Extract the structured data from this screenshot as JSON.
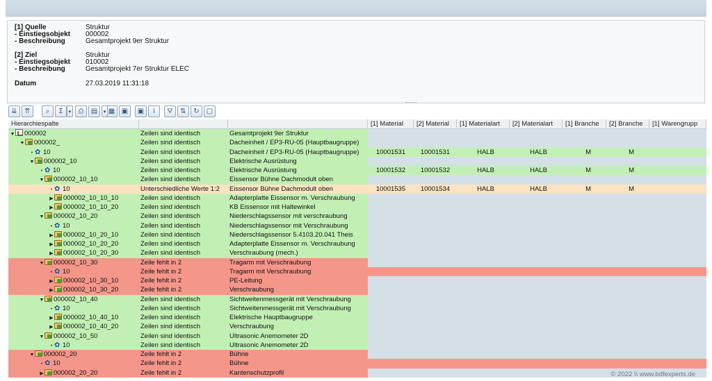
{
  "header": {
    "rows": [
      {
        "label": "[1] Quelle",
        "value": "Struktur"
      },
      {
        "label": "- Einstiegsobjekt",
        "value": "000002"
      },
      {
        "label": "- Beschreibung",
        "value": "Gesamtprojekt 9er Struktur"
      },
      {
        "label": "[2] Ziel",
        "value": "Struktur"
      },
      {
        "label": "- Einstiegsobjekt",
        "value": "010002"
      },
      {
        "label": "- Beschreibung",
        "value": "Gesamtprojekt 7er Struktur ELEC"
      },
      {
        "label": "Datum",
        "value": "27.03.2019 11:31:18"
      }
    ]
  },
  "toolbar": {
    "buttons": [
      {
        "icon": "expand-all-icon",
        "glyph": "⇊"
      },
      {
        "icon": "collapse-all-icon",
        "glyph": "⇈"
      },
      {
        "icon": "find-icon",
        "glyph": "⌕"
      },
      {
        "icon": "sum-icon",
        "glyph": "Σ"
      },
      {
        "icon": "print-icon",
        "glyph": "⎙"
      },
      {
        "icon": "export-icon",
        "glyph": "▤"
      },
      {
        "icon": "layout-icon",
        "glyph": "▦"
      },
      {
        "icon": "layout-save-icon",
        "glyph": "▣"
      },
      {
        "icon": "layout-manage-icon",
        "glyph": "▣"
      },
      {
        "icon": "info-icon",
        "glyph": "i"
      },
      {
        "icon": "filter-icon",
        "glyph": "⛛"
      },
      {
        "icon": "sort-icon",
        "glyph": "⇅"
      },
      {
        "icon": "refresh-icon",
        "glyph": "↻"
      },
      {
        "icon": "details-icon",
        "glyph": "▢"
      }
    ]
  },
  "grid": {
    "columns": [
      "Hierarchiespalte",
      "",
      "",
      "[1] Material",
      "[2] Material",
      "[1] Materialart",
      "[2] Materialart",
      "[1] Branche",
      "[2] Branche",
      "[1] Warengrupp"
    ],
    "rows": [
      {
        "level": 0,
        "exp": "▼",
        "icon": "root",
        "id": "000002",
        "status": "Zeilen sind identisch",
        "desc": "Gesamtprojekt 9er Struktur",
        "color": "g",
        "vals": [
          "",
          "",
          "",
          "",
          "",
          ""
        ]
      },
      {
        "level": 1,
        "exp": "▼",
        "icon": "folder",
        "id": "000002_",
        "status": "Zeilen sind identisch",
        "desc": "Dacheinheit / EP3-RU-05 (Hauptbaugruppe)",
        "color": "g",
        "vals": [
          "",
          "",
          "",
          "",
          "",
          ""
        ]
      },
      {
        "level": 2,
        "exp": "•",
        "icon": "gear",
        "id": "10",
        "status": "Zeilen sind identisch",
        "desc": "Dacheinheit / EP3-RU-05 (Hauptbaugruppe)",
        "color": "g",
        "vals": [
          "10001531",
          "10001531",
          "HALB",
          "HALB",
          "M",
          "M"
        ]
      },
      {
        "level": 2,
        "exp": "▼",
        "icon": "folder",
        "id": "000002_10",
        "status": "Zeilen sind identisch",
        "desc": "Elektrische Ausrüstung",
        "color": "g",
        "vals": [
          "",
          "",
          "",
          "",
          "",
          ""
        ]
      },
      {
        "level": 3,
        "exp": "•",
        "icon": "gear",
        "id": "10",
        "status": "Zeilen sind identisch",
        "desc": "Elektrische Ausrüstung",
        "color": "g",
        "vals": [
          "10001532",
          "10001532",
          "HALB",
          "HALB",
          "M",
          "M"
        ]
      },
      {
        "level": 3,
        "exp": "▼",
        "icon": "folder",
        "id": "000002_10_10",
        "status": "Zeilen sind identisch",
        "desc": "Eissensor Bühne Dachmodult oben",
        "color": "g",
        "vals": [
          "",
          "",
          "",
          "",
          "",
          ""
        ]
      },
      {
        "level": 4,
        "exp": "•",
        "icon": "gear",
        "id": "10",
        "status": "Unterschiedliche Werte 1:2",
        "desc": "Eissensor Bühne Dachmodult oben",
        "color": "o",
        "vals": [
          "10001535",
          "10001534",
          "HALB",
          "HALB",
          "M",
          "M"
        ]
      },
      {
        "level": 4,
        "exp": "▶",
        "icon": "folder",
        "id": "000002_10_10_10",
        "status": "Zeilen sind identisch",
        "desc": "Adapterplatte Eissensor m. Verschraubung",
        "color": "g",
        "vals": [
          "",
          "",
          "",
          "",
          "",
          ""
        ]
      },
      {
        "level": 4,
        "exp": "▶",
        "icon": "folder",
        "id": "000002_10_10_20",
        "status": "Zeilen sind identisch",
        "desc": "KB Eissensor mit Haltewinkel",
        "color": "g",
        "vals": [
          "",
          "",
          "",
          "",
          "",
          ""
        ]
      },
      {
        "level": 3,
        "exp": "▼",
        "icon": "folder",
        "id": "000002_10_20",
        "status": "Zeilen sind identisch",
        "desc": "Niederschlagssensor mit verschraubung",
        "color": "g",
        "vals": [
          "",
          "",
          "",
          "",
          "",
          ""
        ]
      },
      {
        "level": 4,
        "exp": "•",
        "icon": "gear",
        "id": "10",
        "status": "Zeilen sind identisch",
        "desc": "Niederschlagssensor mit Verschraubung",
        "color": "g",
        "vals": [
          "",
          "",
          "",
          "",
          "",
          ""
        ]
      },
      {
        "level": 4,
        "exp": "▶",
        "icon": "folder",
        "id": "000002_10_20_10",
        "status": "Zeilen sind identisch",
        "desc": "Niederschlagssensor 5.4103.20.041 Theis",
        "color": "g",
        "vals": [
          "",
          "",
          "",
          "",
          "",
          ""
        ]
      },
      {
        "level": 4,
        "exp": "▶",
        "icon": "folder",
        "id": "000002_10_20_20",
        "status": "Zeilen sind identisch",
        "desc": "Adapterplatte Eissensor m. Verschraubung",
        "color": "g",
        "vals": [
          "",
          "",
          "",
          "",
          "",
          ""
        ]
      },
      {
        "level": 4,
        "exp": "▶",
        "icon": "folder",
        "id": "000002_10_20_30",
        "status": "Zeilen sind identisch",
        "desc": "Verschraubung (mech.)",
        "color": "g",
        "vals": [
          "",
          "",
          "",
          "",
          "",
          ""
        ]
      },
      {
        "level": 3,
        "exp": "▼",
        "icon": "folder",
        "id": "000002_10_30",
        "status": "Zeile fehlt in 2",
        "desc": "Tragarm mit Verschraubung",
        "color": "r",
        "vals": [
          "",
          "",
          "",
          "",
          "",
          ""
        ]
      },
      {
        "level": 4,
        "exp": "•",
        "icon": "gear",
        "id": "10",
        "status": "Zeile fehlt in 2",
        "desc": "Tragarm mit Verschraubung",
        "color": "r",
        "vals": [
          "",
          "",
          "",
          "",
          "",
          ""
        ]
      },
      {
        "level": 4,
        "exp": "▶",
        "icon": "folder",
        "id": "000002_10_30_10",
        "status": "Zeile fehlt in 2",
        "desc": "PE-Leitung",
        "color": "r",
        "vals": [
          "",
          "",
          "",
          "",
          "",
          ""
        ]
      },
      {
        "level": 4,
        "exp": "▶",
        "icon": "folder",
        "id": "000002_10_30_20",
        "status": "Zeile fehlt in 2",
        "desc": "Verschraubung",
        "color": "r",
        "vals": [
          "",
          "",
          "",
          "",
          "",
          ""
        ]
      },
      {
        "level": 3,
        "exp": "▼",
        "icon": "folder",
        "id": "000002_10_40",
        "status": "Zeilen sind identisch",
        "desc": "Sichtweitenmessgerät mit Verschraubung",
        "color": "g",
        "vals": [
          "",
          "",
          "",
          "",
          "",
          ""
        ]
      },
      {
        "level": 4,
        "exp": "•",
        "icon": "gear",
        "id": "10",
        "status": "Zeilen sind identisch",
        "desc": "Sichtweitenmessgerät mit Verschraubung",
        "color": "g",
        "vals": [
          "",
          "",
          "",
          "",
          "",
          ""
        ]
      },
      {
        "level": 4,
        "exp": "▶",
        "icon": "folder",
        "id": "000002_10_40_10",
        "status": "Zeilen sind identisch",
        "desc": "Elektrische Hauptbaugruppe",
        "color": "g",
        "vals": [
          "",
          "",
          "",
          "",
          "",
          ""
        ]
      },
      {
        "level": 4,
        "exp": "▶",
        "icon": "folder",
        "id": "000002_10_40_20",
        "status": "Zeilen sind identisch",
        "desc": "Verschraubung",
        "color": "g",
        "vals": [
          "",
          "",
          "",
          "",
          "",
          ""
        ]
      },
      {
        "level": 3,
        "exp": "▼",
        "icon": "folder",
        "id": "000002_10_50",
        "status": "Zeilen sind identisch",
        "desc": "Ultrasonic Anemometer 2D",
        "color": "g",
        "vals": [
          "",
          "",
          "",
          "",
          "",
          ""
        ]
      },
      {
        "level": 4,
        "exp": "•",
        "icon": "gear",
        "id": "10",
        "status": "Zeilen sind identisch",
        "desc": "Ultrasonic Anemometer 2D",
        "color": "g",
        "vals": [
          "",
          "",
          "",
          "",
          "",
          ""
        ]
      },
      {
        "level": 2,
        "exp": "▼",
        "icon": "folder",
        "id": "000002_20",
        "status": "Zeile fehlt in 2",
        "desc": "Bühne",
        "color": "r",
        "vals": [
          "",
          "",
          "",
          "",
          "",
          ""
        ]
      },
      {
        "level": 3,
        "exp": "•",
        "icon": "gear",
        "id": "10",
        "status": "Zeile fehlt in 2",
        "desc": "Bühne",
        "color": "r",
        "vals": [
          "",
          "",
          "",
          "",
          "",
          ""
        ]
      },
      {
        "level": 3,
        "exp": "▶",
        "icon": "folder",
        "id": "000002_20_20",
        "status": "Zeile fehlt in 2",
        "desc": "Kantenschutzprofil",
        "color": "r",
        "vals": [
          "",
          "",
          "",
          "",
          "",
          ""
        ]
      }
    ]
  },
  "colors": {
    "identical": "#c2f0b4",
    "missing": "#f5968a",
    "different": "#fbe3c2",
    "empty": "#d4e0e6"
  },
  "copyright": "© 2022 \\\\ www.bdfexperts.de"
}
